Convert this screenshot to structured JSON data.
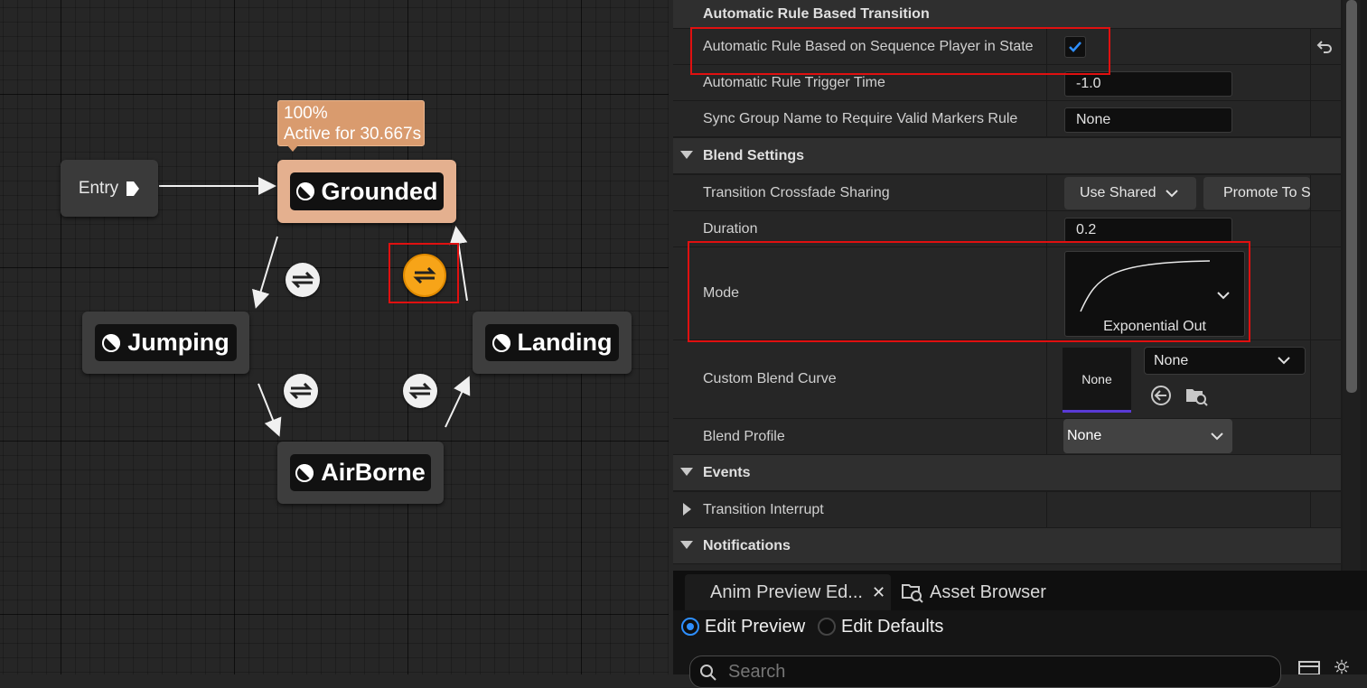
{
  "graph": {
    "entry_label": "Entry",
    "status": {
      "weight": "100%",
      "active": "Active for 30.667s"
    },
    "states": {
      "grounded": "Grounded",
      "jumping": "Jumping",
      "landing": "Landing",
      "airborne": "AirBorne"
    }
  },
  "details": {
    "section_header": "Automatic Rule Based Transition",
    "rows": {
      "auto_rule": {
        "label": "Automatic Rule Based on Sequence Player in State",
        "checked": true
      },
      "trigger_time": {
        "label": "Automatic Rule Trigger Time",
        "value": "-1.0"
      },
      "sync_group": {
        "label": "Sync Group Name to Require Valid Markers Rule",
        "value": "None"
      }
    },
    "blend_settings": {
      "header": "Blend Settings",
      "crossfade": {
        "label": "Transition Crossfade Sharing",
        "value": "Use Shared",
        "promote_button": "Promote To S"
      },
      "duration": {
        "label": "Duration",
        "value": "0.2"
      },
      "mode": {
        "label": "Mode",
        "value": "Exponential Out"
      },
      "custom_curve": {
        "label": "Custom Blend Curve",
        "thumb_label": "None",
        "value": "None"
      },
      "blend_profile": {
        "label": "Blend Profile",
        "value": "None"
      }
    },
    "events": {
      "header": "Events",
      "transition_interrupt": "Transition Interrupt"
    },
    "notifications": {
      "header": "Notifications"
    }
  },
  "preview": {
    "tabs": [
      {
        "label": "Anim Preview Ed..."
      },
      {
        "label": "Asset Browser"
      }
    ],
    "radios": {
      "edit_preview": "Edit Preview",
      "edit_defaults": "Edit Defaults"
    },
    "search_placeholder": "Search"
  },
  "colors": {
    "active_state": "#e4b08f",
    "selected_transition": "#f7a418",
    "highlight_box": "#e01010",
    "checkbox_accent": "#2e8fff"
  }
}
